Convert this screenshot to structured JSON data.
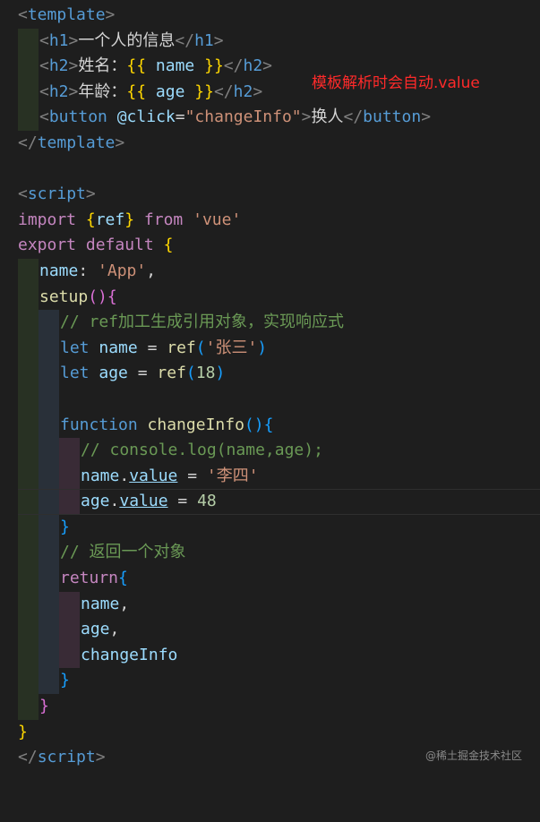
{
  "annotation": "模板解析时会自动.value",
  "watermark": "@稀土掘金技术社区",
  "code": {
    "h1_text": "一个人的信息",
    "h2_name_label": "姓名：",
    "h2_age_label": "年龄：",
    "name_var": "name",
    "age_var": "age",
    "click_attr": "@click",
    "click_handler": "\"changeInfo\"",
    "button_text": "换人",
    "import_name": "ref",
    "import_source": "'vue'",
    "component_name": "'App'",
    "comment_ref": "// ref加工生成引用对象，实现响应式",
    "initial_name": "'张三'",
    "initial_age": "18",
    "function_name": "changeInfo",
    "comment_log": "// console.log(name,age);",
    "new_name": "'李四'",
    "new_age": "48",
    "comment_return": "// 返回一个对象"
  }
}
